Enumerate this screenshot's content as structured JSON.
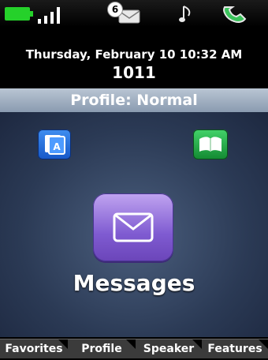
{
  "status": {
    "message_count": "6",
    "icons": [
      "battery-icon",
      "signal-icon",
      "voicemail-envelope-icon",
      "ringtone-note-icon",
      "handset-icon"
    ]
  },
  "header": {
    "date_time": "Thursday, February 10 10:32 AM",
    "extension": "1011"
  },
  "profile": {
    "label": "Profile: Normal"
  },
  "home": {
    "apps": [
      {
        "icon": "directory-app-icon",
        "accent": "#1f6de0"
      },
      {
        "icon": "book-app-icon",
        "accent": "#21a84a"
      }
    ],
    "focused_app": {
      "label": "Messages",
      "icon": "envelope-icon",
      "accent": "#8b67d6"
    }
  },
  "softkeys": [
    "Favorites",
    "Profile",
    "Speaker",
    "Features"
  ],
  "colors": {
    "background": "#2b3a55",
    "profile_bar": "#9aa9bc",
    "softkey": "#3b3b3b"
  }
}
